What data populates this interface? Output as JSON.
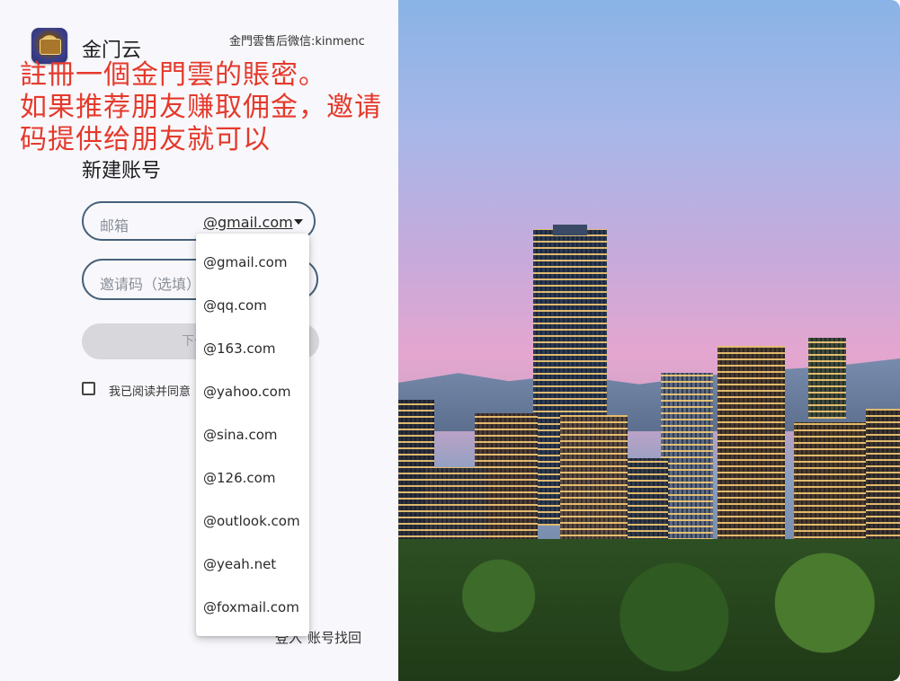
{
  "header": {
    "app_name": "金门云",
    "support": "金門雲售后微信:kinmenc"
  },
  "overlay": {
    "lines": [
      "註冊一個金門雲的賬密。",
      "如果推荐朋友赚取佣金，邀请",
      "码提供给朋友就可以"
    ],
    "color": "#e5392b"
  },
  "form": {
    "title": "新建账号",
    "email_placeholder": "邮箱",
    "selected_domain": "@gmail.com",
    "invite_placeholder": "邀请码（选填）",
    "next_label": "下一步",
    "agree_text": "我已阅读并同意"
  },
  "dropdown": {
    "options": [
      "@gmail.com",
      "@qq.com",
      "@163.com",
      "@yahoo.com",
      "@sina.com",
      "@126.com",
      "@outlook.com",
      "@yeah.net",
      "@foxmail.com"
    ]
  },
  "footer": {
    "login": "登入",
    "recover": "账号找回"
  }
}
